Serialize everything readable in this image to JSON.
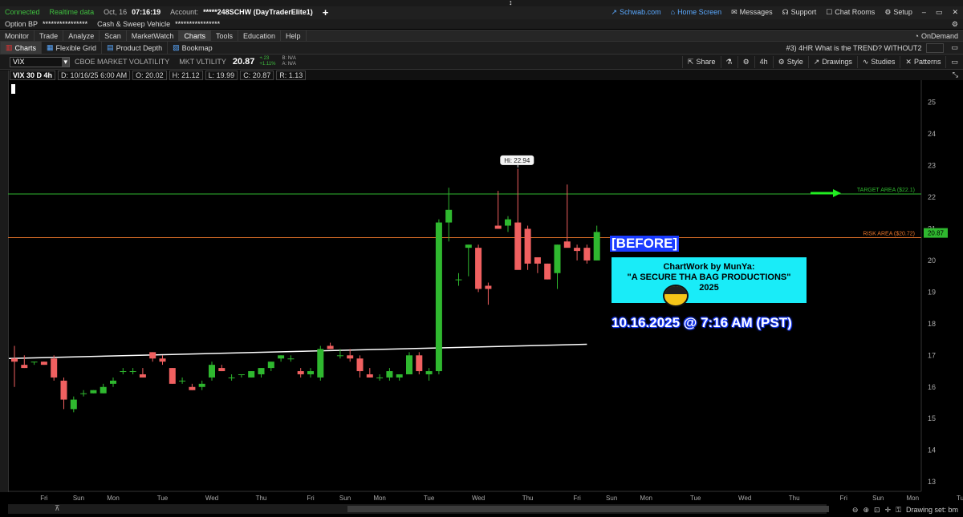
{
  "topbar": {
    "status": "Connected",
    "feed": "Realtime data",
    "date": "Oct, 16",
    "time": "07:16:19",
    "account_label": "Account:",
    "account_value": "*****248SCHW (DayTraderElite1)",
    "add": "+",
    "links": [
      {
        "icon": "schwab-icon",
        "label": "Schwab.com"
      },
      {
        "icon": "home-icon",
        "label": "Home Screen"
      },
      {
        "icon": "mail-icon",
        "label": "Messages"
      },
      {
        "icon": "headset-icon",
        "label": "Support"
      },
      {
        "icon": "chat-icon",
        "label": "Chat Rooms"
      },
      {
        "icon": "gear-icon",
        "label": "Setup"
      }
    ],
    "window_buttons": [
      "–",
      "▭",
      "✕"
    ]
  },
  "account_bar": {
    "option_label": "Option BP",
    "option_value": "****************",
    "sweep_label": "Cash & Sweep Vehicle",
    "sweep_value": "****************"
  },
  "menu": {
    "tabs": [
      "Monitor",
      "Trade",
      "Analyze",
      "Scan",
      "MarketWatch",
      "Charts",
      "Tools",
      "Education",
      "Help"
    ],
    "active": "Charts",
    "ondemand": "OnDemand"
  },
  "subtabs": {
    "items": [
      "Charts",
      "Flexible Grid",
      "Product Depth",
      "Bookmap"
    ],
    "active": "Charts",
    "grid_title": "#3) 4HR What is the TREND? WITHOUT2"
  },
  "symbolbar": {
    "symbol": "VIX",
    "desc": "CBOE MARKET VOLATILITY",
    "exchange": "MKT VLTILITY",
    "last": "20.87",
    "change": "+.23",
    "change_pct": "+1.11%",
    "bid": "B: N/A",
    "ask": "A: N/A",
    "tools": [
      "Share",
      "Drawings",
      "Studies",
      "Patterns"
    ],
    "timeframe": "4h",
    "style": "Style"
  },
  "infobar": {
    "title": "VIX 30 D 4h",
    "d": "D: 10/16/25 6:00 AM",
    "o": "O: 20.02",
    "h": "H: 21.12",
    "l": "L: 19.99",
    "c": "C: 20.87",
    "r": "R: 1.13"
  },
  "overlay": {
    "before": "[BEFORE]",
    "note_line1": "ChartWork by MunYa:",
    "note_line2": "\"A SECURE THA BAG PRODUCTIONS\"",
    "note_line3": "2025",
    "big_date": "10.16.2025 @ 7:16 AM (PST)"
  },
  "bottom": {
    "drawing_set": "Drawing set: bm"
  },
  "chart_data": {
    "type": "candlestick",
    "ylim": [
      12.7,
      25.7
    ],
    "yticks": [
      13,
      14,
      15,
      16,
      17,
      18,
      19,
      20,
      21,
      22,
      23,
      24,
      25
    ],
    "xlabels": [
      {
        "i": 3,
        "t": "Fri"
      },
      {
        "i": 6.5,
        "t": "Sun"
      },
      {
        "i": 10,
        "t": "Mon"
      },
      {
        "i": 15,
        "t": "Tue"
      },
      {
        "i": 20,
        "t": "Wed"
      },
      {
        "i": 25,
        "t": "Thu"
      },
      {
        "i": 30,
        "t": "Fri"
      },
      {
        "i": 33.5,
        "t": "Sun"
      },
      {
        "i": 37,
        "t": "Mon"
      },
      {
        "i": 42,
        "t": "Tue"
      },
      {
        "i": 47,
        "t": "Wed"
      },
      {
        "i": 52,
        "t": "Thu"
      },
      {
        "i": 57,
        "t": "Fri"
      },
      {
        "i": 60.5,
        "t": "Sun"
      },
      {
        "i": 64,
        "t": "Mon"
      },
      {
        "i": 69,
        "t": "Tue"
      },
      {
        "i": 74,
        "t": "Wed"
      },
      {
        "i": 79,
        "t": "Thu"
      },
      {
        "i": 84,
        "t": "Fri"
      },
      {
        "i": 87.5,
        "t": "Sun"
      },
      {
        "i": 91,
        "t": "Mon"
      },
      {
        "i": 96,
        "t": "Tue"
      },
      {
        "i": 101,
        "t": "Wed"
      },
      {
        "i": 106,
        "t": "Thu"
      }
    ],
    "candles": [
      [
        16.9,
        17.3,
        16.0,
        16.8
      ],
      [
        16.7,
        17.0,
        16.6,
        16.6
      ],
      [
        16.8,
        16.8,
        16.7,
        16.8
      ],
      [
        16.8,
        16.8,
        16.7,
        16.7
      ],
      [
        16.9,
        17.0,
        16.2,
        16.3
      ],
      [
        16.2,
        16.3,
        15.3,
        15.6
      ],
      [
        15.3,
        15.7,
        15.2,
        15.6
      ],
      [
        15.8,
        15.9,
        15.7,
        15.8
      ],
      [
        15.8,
        15.9,
        15.8,
        15.9
      ],
      [
        15.8,
        16.1,
        15.8,
        16.0
      ],
      [
        16.1,
        16.3,
        16.0,
        16.2
      ],
      [
        16.5,
        16.6,
        16.4,
        16.5
      ],
      [
        16.5,
        16.6,
        16.4,
        16.5
      ],
      [
        16.4,
        16.6,
        16.3,
        16.3
      ],
      [
        17.1,
        17.1,
        16.8,
        16.9
      ],
      [
        16.9,
        17.0,
        16.7,
        16.8
      ],
      [
        16.6,
        16.6,
        16.1,
        16.1
      ],
      [
        16.2,
        16.3,
        16.1,
        16.2
      ],
      [
        16.0,
        16.1,
        15.9,
        15.9
      ],
      [
        16.0,
        16.2,
        15.9,
        16.1
      ],
      [
        16.3,
        16.8,
        16.2,
        16.7
      ],
      [
        16.6,
        16.7,
        16.5,
        16.5
      ],
      [
        16.3,
        16.4,
        16.2,
        16.3
      ],
      [
        16.4,
        16.4,
        16.3,
        16.4
      ],
      [
        16.3,
        16.5,
        16.3,
        16.5
      ],
      [
        16.4,
        16.6,
        16.3,
        16.6
      ],
      [
        16.6,
        16.8,
        16.5,
        16.8
      ],
      [
        16.9,
        17.0,
        16.8,
        17.0
      ],
      [
        16.9,
        17.0,
        16.8,
        16.9
      ],
      [
        16.5,
        16.6,
        16.3,
        16.4
      ],
      [
        16.4,
        16.6,
        16.3,
        16.5
      ],
      [
        16.3,
        17.3,
        16.2,
        17.2
      ],
      [
        17.3,
        17.4,
        17.2,
        17.2
      ],
      [
        17.0,
        17.2,
        16.9,
        17.0
      ],
      [
        17.0,
        17.2,
        16.8,
        16.9
      ],
      [
        16.9,
        17.0,
        16.3,
        16.5
      ],
      [
        16.4,
        16.6,
        16.3,
        16.3
      ],
      [
        16.3,
        16.4,
        16.2,
        16.3
      ],
      [
        16.3,
        16.6,
        16.2,
        16.5
      ],
      [
        16.3,
        16.4,
        16.2,
        16.4
      ],
      [
        16.4,
        17.1,
        16.4,
        17.0
      ],
      [
        17.0,
        17.1,
        16.4,
        16.5
      ],
      [
        16.4,
        16.6,
        16.2,
        16.5
      ],
      [
        16.5,
        21.3,
        16.4,
        21.2
      ],
      [
        21.2,
        22.3,
        20.6,
        21.6
      ],
      [
        19.4,
        19.6,
        19.2,
        19.4
      ],
      [
        20.4,
        20.5,
        19.5,
        20.5
      ],
      [
        20.4,
        20.5,
        19.0,
        19.1
      ],
      [
        19.2,
        19.3,
        18.6,
        19.1
      ],
      [
        21.1,
        22.2,
        21.0,
        21.0
      ],
      [
        21.1,
        21.4,
        20.9,
        21.3
      ],
      [
        21.2,
        22.9,
        19.8,
        19.7
      ],
      [
        21.0,
        21.1,
        19.7,
        19.9
      ],
      [
        20.1,
        20.1,
        19.6,
        19.9
      ],
      [
        19.9,
        19.9,
        19.4,
        19.4
      ],
      [
        19.6,
        20.5,
        19.1,
        20.5
      ],
      [
        20.6,
        22.4,
        20.5,
        20.4
      ],
      [
        20.4,
        20.5,
        20.0,
        20.3
      ],
      [
        20.4,
        20.5,
        19.9,
        20.0
      ],
      [
        20.0,
        21.1,
        20.0,
        20.9
      ]
    ],
    "hi_label": "Hi: 22.94",
    "hi_index": 51,
    "hi_value": 22.94,
    "target": {
      "label": "TARGET AREA  ($22.1)",
      "value": 22.1
    },
    "risk": {
      "label": "RISK AREA  ($20.72)",
      "value": 20.72
    },
    "last_price": {
      "value": 20.87,
      "label": "20.87"
    },
    "trendline": {
      "from": [
        0,
        16.9
      ],
      "to": [
        58,
        17.35
      ]
    },
    "colors": {
      "up": "#2fb82f",
      "down": "#f06060",
      "target": "#2fb82f",
      "risk": "#e8752a",
      "arrow": "#22ee22",
      "trend": "#ffffff"
    }
  }
}
